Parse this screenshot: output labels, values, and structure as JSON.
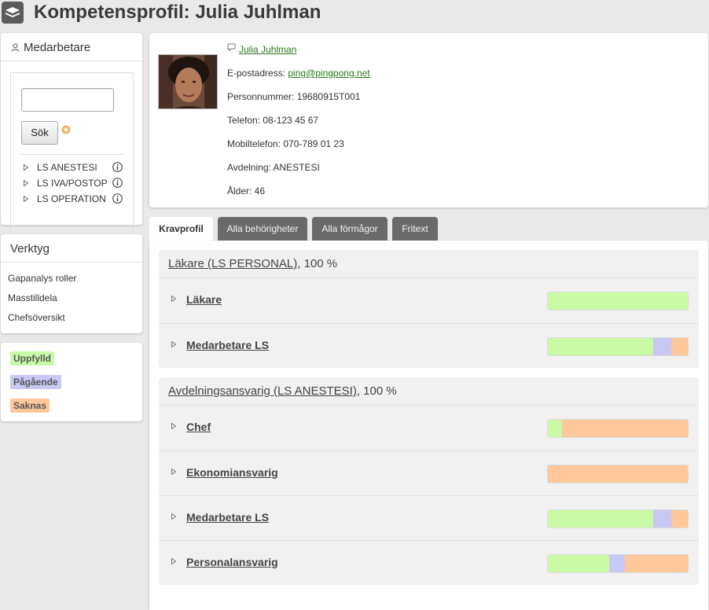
{
  "page": {
    "title": "Kompetensprofil: Julia Juhlman"
  },
  "colors": {
    "fulfilled": "#cafaa6",
    "ongoing": "#c8c8f4",
    "missing": "#ffc79a",
    "link_green": "#2a7a1d"
  },
  "employee_panel": {
    "title": "Medarbetare",
    "search_button": "Sök",
    "departments": [
      {
        "label": "LS ANESTESI"
      },
      {
        "label": "LS IVA/POSTOP"
      },
      {
        "label": "LS OPERATION"
      }
    ]
  },
  "tools_panel": {
    "title": "Verktyg",
    "items": [
      {
        "label": "Gapanalys roller"
      },
      {
        "label": "Masstilldela"
      },
      {
        "label": "Chefsöversikt"
      }
    ]
  },
  "legend": {
    "fulfilled": "Uppfylld",
    "ongoing": "Pågående",
    "missing": "Saknas"
  },
  "profile": {
    "name": "Julia Juhlman",
    "email_label": "E-postadress: ",
    "email": "ping@pingpong.net",
    "personnummer": "Personnummer: 19680915T001",
    "phone": "Telefon: 08-123 45 67",
    "mobile": "Mobiltelefon: 070-789 01 23",
    "department": "Avdelning: ANESTESI",
    "age": "Ålder: 46"
  },
  "tabs": [
    {
      "label": "Kravprofil",
      "active": true
    },
    {
      "label": "Alla behörigheter",
      "active": false
    },
    {
      "label": "Alla förmågor",
      "active": false
    },
    {
      "label": "Fritext",
      "active": false
    }
  ],
  "groups": [
    {
      "name": "Läkare (LS PERSONAL)",
      "percent": ", 100 %",
      "requirements": [
        {
          "name": "Läkare",
          "fulfilled": 1.0,
          "ongoing": 0.0,
          "missing": 0.0
        },
        {
          "name": "Medarbetare LS",
          "fulfilled": 0.75,
          "ongoing": 0.13,
          "missing": 0.12
        }
      ]
    },
    {
      "name": "Avdelningsansvarig (LS ANESTESI)",
      "percent": ", 100 %",
      "requirements": [
        {
          "name": "Chef",
          "fulfilled": 0.1,
          "ongoing": 0.0,
          "missing": 0.9
        },
        {
          "name": "Ekonomiansvarig",
          "fulfilled": 0.0,
          "ongoing": 0.0,
          "missing": 1.0
        },
        {
          "name": "Medarbetare LS",
          "fulfilled": 0.75,
          "ongoing": 0.13,
          "missing": 0.12
        },
        {
          "name": "Personalansvarig",
          "fulfilled": 0.44,
          "ongoing": 0.11,
          "missing": 0.45
        }
      ]
    }
  ]
}
